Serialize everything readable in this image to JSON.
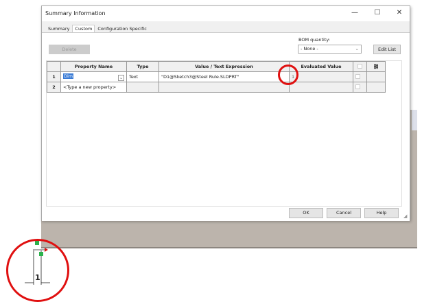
{
  "dialog": {
    "title": "Summary Information",
    "minimize": "—",
    "maximize": "☐",
    "close": "✕"
  },
  "tabs": [
    {
      "label": "Summary"
    },
    {
      "label": "Custom"
    },
    {
      "label": "Configuration Specific"
    }
  ],
  "toolbar": {
    "delete_label": "Delete",
    "bom_label": "BOM quantity:",
    "bom_value": "- None -",
    "edit_list_label": "Edit List"
  },
  "table": {
    "headers": [
      "",
      "Property Name",
      "Type",
      "Value / Text Expression",
      "Evaluated Value",
      "",
      ""
    ],
    "rows": [
      {
        "num": "1",
        "name": "Dim",
        "type": "Text",
        "value": "\"D1@Sketch3@Steel Rule.SLDPRT\"",
        "evaluated": "1"
      },
      {
        "num": "2",
        "name": "<Type a new property>",
        "type": "",
        "value": "",
        "evaluated": ""
      }
    ]
  },
  "buttons": {
    "ok": "OK",
    "cancel": "Cancel",
    "help": "Help"
  },
  "sketch": {
    "dimension": "1"
  },
  "colors": {
    "highlight": "#e01010",
    "selection": "#3a7bd5"
  }
}
